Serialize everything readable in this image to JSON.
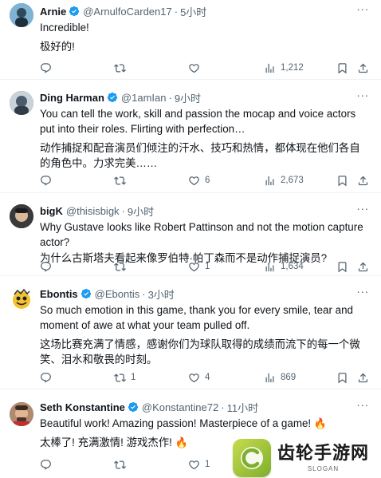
{
  "tweets": [
    {
      "name": "Arnie",
      "handle": "@ArnulfoCarden17",
      "time": "5小时",
      "lines": [
        "Incredible!",
        "极好的!"
      ],
      "replies": "",
      "retweets": "",
      "likes": "",
      "views": "1,212",
      "avatar_color": "#5a8fb0"
    },
    {
      "name": "Ding Harman",
      "handle": "@1amIan",
      "time": "9小时",
      "lines": [
        "You can tell the work, skill and passion the mocap and voice actors put into their roles. Flirting with perfection…",
        "动作捕捉和配音演员们倾注的汗水、技巧和热情，都体现在他们各自的角色中。力求完美……"
      ],
      "replies": "",
      "retweets": "",
      "likes": "6",
      "views": "2,673",
      "avatar_color": "#3b4a5c"
    },
    {
      "name": "bigK",
      "handle": "@thisisbigk",
      "time": "9小时",
      "lines": [
        "Why Gustave looks like Robert Pattinson and not the motion capture actor?",
        "为什么古斯塔夫看起来像罗伯特·帕丁森而不是动作捕捉演员?"
      ],
      "replies": "",
      "retweets": "",
      "likes": "1",
      "views": "1,634",
      "avatar_color": "#2b2b2b"
    },
    {
      "name": "Ebontis",
      "handle": "@Ebontis",
      "time": "3小时",
      "lines": [
        "So much emotion in this game, thank you for every smile, tear and moment of awe at what your team pulled off.",
        "这场比赛充满了情感，感谢你们为球队取得的成绩而流下的每一个微笑、泪水和敬畏的时刻。"
      ],
      "replies": "",
      "retweets": "1",
      "likes": "4",
      "views": "869",
      "avatar_color": "#f2c230"
    },
    {
      "name": "Seth Konstantine",
      "handle": "@Konstantine72",
      "time": "11小时",
      "lines": [
        "Beautiful work! Amazing passion! Masterpiece of a game!",
        "太棒了! 充满激情! 游戏杰作!"
      ],
      "replies": "",
      "retweets": "",
      "likes": "1",
      "views": "",
      "avatar_color": "#7a5a4a"
    }
  ],
  "watermark": {
    "title": "齿轮手游网",
    "slogan": "SLOGAN"
  },
  "colors": {
    "verified": "#1d9bf0",
    "muted": "#536471",
    "text": "#0f1419",
    "border": "#eff3f4"
  }
}
